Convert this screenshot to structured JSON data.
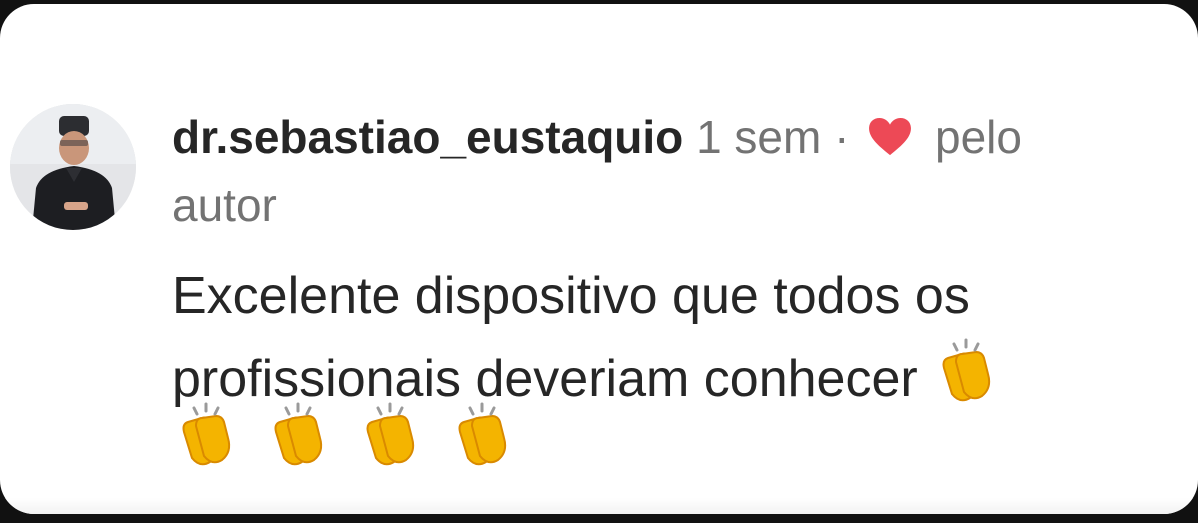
{
  "comment": {
    "username": "dr.sebastiao_eustaquio",
    "time_ago": "1 sem",
    "separator": "·",
    "liked_by_author_prefix": "pelo",
    "liked_by_author_suffix": "autor",
    "text_line_1": "Excelente dispositivo que todos os",
    "text_line_2": "profissionais deveriam conhecer",
    "emoji": "👏",
    "emoji_count": 5
  },
  "colors": {
    "heart": "#ed4956",
    "username": "#262626",
    "meta": "#737373",
    "background": "#ffffff"
  },
  "icons": {
    "heart": "heart-icon",
    "clap": "clapping-hands-icon"
  }
}
